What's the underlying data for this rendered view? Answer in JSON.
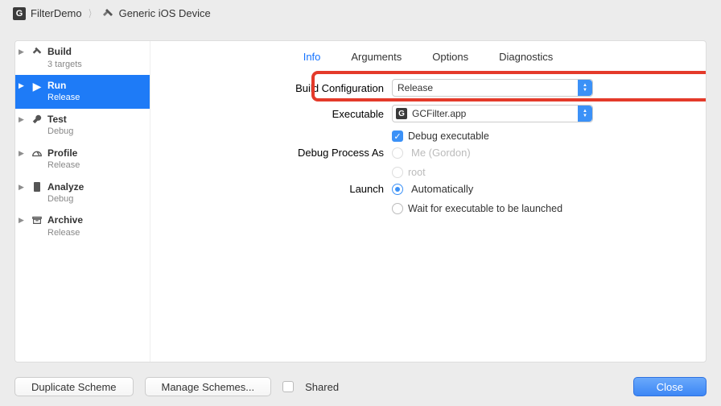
{
  "breadcrumb": {
    "project": "FilterDemo",
    "target": "Generic iOS Device"
  },
  "sidebar": {
    "items": [
      {
        "title": "Build",
        "sub": "3 targets"
      },
      {
        "title": "Run",
        "sub": "Release"
      },
      {
        "title": "Test",
        "sub": "Debug"
      },
      {
        "title": "Profile",
        "sub": "Release"
      },
      {
        "title": "Analyze",
        "sub": "Debug"
      },
      {
        "title": "Archive",
        "sub": "Release"
      }
    ]
  },
  "tabs": {
    "info": "Info",
    "arguments": "Arguments",
    "options": "Options",
    "diagnostics": "Diagnostics"
  },
  "form": {
    "buildConfigLabel": "Build Configuration",
    "buildConfigValue": "Release",
    "executableLabel": "Executable",
    "executableValue": "GCFilter.app",
    "debugExecLabel": "Debug executable",
    "debugProcessLabel": "Debug Process As",
    "meLabel": "Me (Gordon)",
    "rootLabel": "root",
    "launchLabel": "Launch",
    "autoLabel": "Automatically",
    "waitLabel": "Wait for executable to be launched"
  },
  "footer": {
    "duplicate": "Duplicate Scheme",
    "manage": "Manage Schemes...",
    "shared": "Shared",
    "close": "Close"
  }
}
